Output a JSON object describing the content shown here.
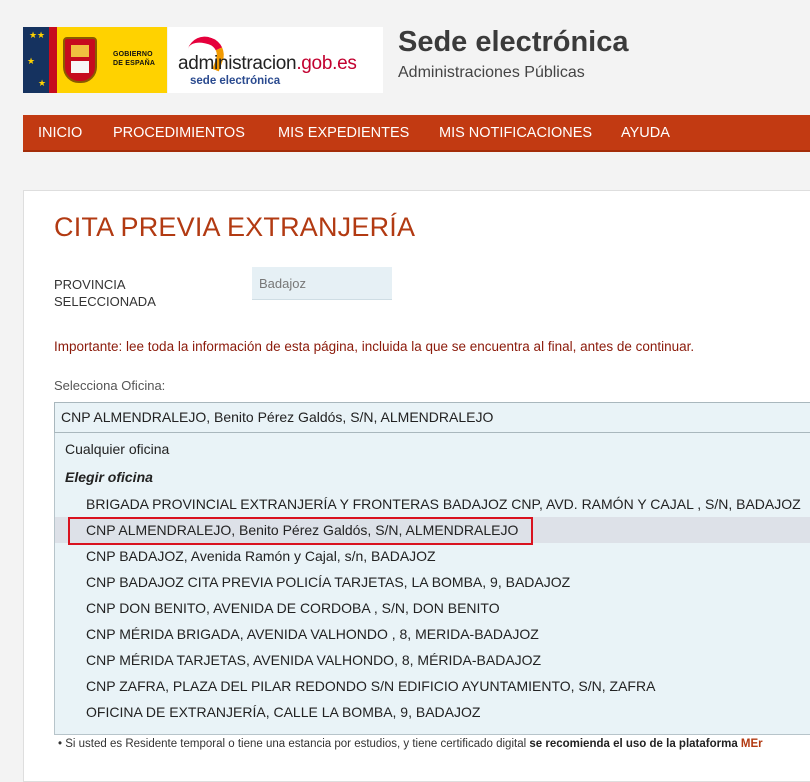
{
  "header": {
    "gov_logo_text": "GOBIERNO\nDE ESPAÑA",
    "admin_logo_name_a": "administracion",
    "admin_logo_name_b": ".gob.es",
    "admin_logo_sub": "sede electrónica",
    "title": "Sede electrónica",
    "subtitle": "Administraciones Públicas"
  },
  "nav": {
    "items": [
      "INICIO",
      "PROCEDIMIENTOS",
      "MIS EXPEDIENTES",
      "MIS NOTIFICACIONES",
      "AYUDA"
    ]
  },
  "main": {
    "title": "CITA PREVIA EXTRANJERÍA",
    "province_label": "PROVINCIA SELECCIONADA",
    "province_value": "Badajoz",
    "important": "Importante: lee toda la información de esta página, incluida la que se encuentra al final, antes de continuar.",
    "office_label": "Selecciona Oficina:",
    "selected_office": "CNP ALMENDRALEJO, Benito Pérez Galdós, S/N, ALMENDRALEJO",
    "dropdown": {
      "any_option": "Cualquier oficina",
      "group_label": "Elegir oficina",
      "options": [
        "BRIGADA PROVINCIAL EXTRANJERÍA Y FRONTERAS BADAJOZ CNP, AVD. RAMÓN Y CAJAL , S/N, BADAJOZ",
        "CNP ALMENDRALEJO, Benito Pérez Galdós, S/N, ALMENDRALEJO",
        "CNP BADAJOZ, Avenida Ramón y Cajal, s/n, BADAJOZ",
        "CNP BADAJOZ CITA PREVIA POLICÍA TARJETAS, LA BOMBA, 9, BADAJOZ",
        "CNP DON BENITO, AVENIDA DE CORDOBA , S/N, DON BENITO",
        "CNP MÉRIDA BRIGADA, AVENIDA VALHONDO , 8, MERIDA-BADAJOZ",
        "CNP MÉRIDA TARJETAS, AVENIDA VALHONDO, 8, MÉRIDA-BADAJOZ",
        "CNP ZAFRA, PLAZA DEL PILAR REDONDO S/N EDIFICIO AYUNTAMIENTO, S/N, ZAFRA",
        "OFICINA DE EXTRANJERÍA, CALLE LA BOMBA, 9, BADAJOZ"
      ]
    },
    "footnote_bullet": "•",
    "footnote_text": "Si usted es Residente temporal o tiene una estancia por estudios, y tiene certificado digital",
    "footnote_bold": "se recomienda el uso de la plataforma",
    "footnote_mark": "MEr"
  },
  "colors": {
    "nav_bg": "#c23a12",
    "title": "#b23a12",
    "important": "#8b1a0a",
    "highlight_border": "#d9121f",
    "select_bg": "#e9f3f7"
  }
}
